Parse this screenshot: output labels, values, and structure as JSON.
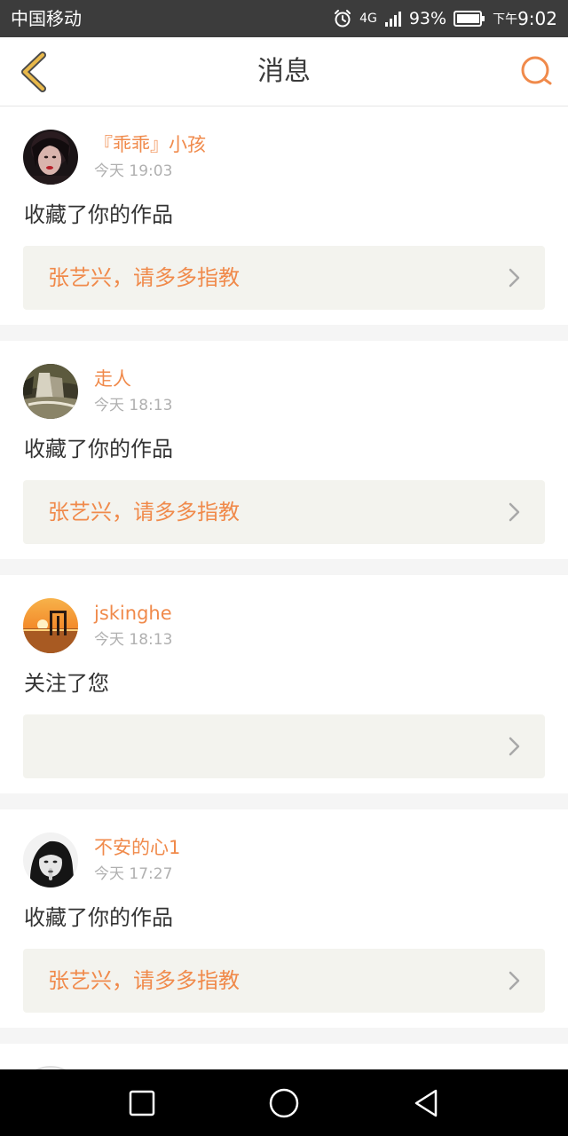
{
  "status_bar": {
    "carrier": "中国移动",
    "network": "4G",
    "battery_percent": "93%",
    "time_prefix": "下午",
    "time": "9:02",
    "icons": [
      "alarm-icon",
      "signal-icon",
      "battery-icon"
    ]
  },
  "header": {
    "title": "消息",
    "back_icon": "back-chevron-icon",
    "search_icon": "search-icon"
  },
  "colors": {
    "accent": "#f08a4b",
    "back_icon": "#e8b84a",
    "status_bar_bg": "#3c3c3c",
    "card_bg": "#ffffff",
    "work_box_bg": "#f3f3ee"
  },
  "messages": [
    {
      "username": "『乖乖』小孩",
      "timestamp": "今天 19:03",
      "action": "收藏了你的作品",
      "work_title": "张艺兴，请多多指教",
      "avatar": "avatar-girl-portrait"
    },
    {
      "username": "走人",
      "timestamp": "今天 18:13",
      "action": "收藏了你的作品",
      "work_title": "张艺兴，请多多指教",
      "avatar": "avatar-waterfall"
    },
    {
      "username": "jskinghe",
      "timestamp": "今天 18:13",
      "action": "关注了您",
      "work_title": "",
      "avatar": "avatar-sunset"
    },
    {
      "username": "不安的心1",
      "timestamp": "今天 17:27",
      "action": "收藏了你的作品",
      "work_title": "张艺兴，请多多指教",
      "avatar": "avatar-bw-portrait"
    }
  ],
  "nav_bar": {
    "buttons": [
      "recent-apps-button",
      "home-button",
      "back-button"
    ]
  }
}
